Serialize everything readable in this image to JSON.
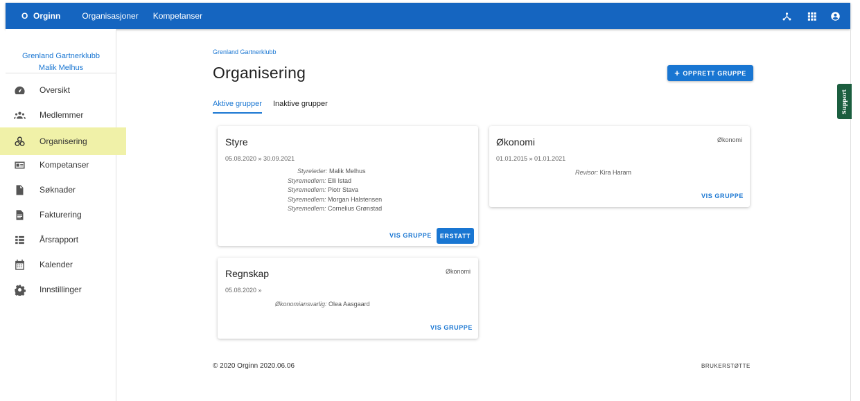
{
  "topbar": {
    "logo_letter": "O",
    "app_name": "Orginn",
    "nav": [
      "Organisasjoner",
      "Kompetanser"
    ],
    "icons": [
      "network-icon",
      "apps-grid-icon",
      "account-circle-icon"
    ]
  },
  "sidebar": {
    "club": "Grenland Gartnerklubb",
    "user": "Malik Melhus",
    "items": [
      {
        "label": "Oversikt",
        "icon": "dashboard-icon"
      },
      {
        "label": "Medlemmer",
        "icon": "members-icon"
      },
      {
        "label": "Organisering",
        "icon": "organisation-icon",
        "active": true
      },
      {
        "label": "Kompetanser",
        "icon": "id-card-icon"
      },
      {
        "label": "Søknader",
        "icon": "document-icon"
      },
      {
        "label": "Fakturering",
        "icon": "invoice-icon"
      },
      {
        "label": "Årsrapport",
        "icon": "report-list-icon"
      },
      {
        "label": "Kalender",
        "icon": "calendar-icon"
      },
      {
        "label": "Innstillinger",
        "icon": "settings-icon"
      }
    ]
  },
  "main": {
    "breadcrumb": "Grenland Gartnerklubb",
    "title": "Organisering",
    "create_button": "OPPRETT GRUPPE",
    "tabs": [
      "Aktive grupper",
      "Inaktive grupper"
    ],
    "cards": [
      {
        "title": "Styre",
        "tag": "",
        "dates": "05.08.2020 » 30.09.2021",
        "roles": [
          {
            "role": "Styreleder:",
            "name": "Malik Melhus"
          },
          {
            "role": "Styremedlem:",
            "name": "Elli Istad"
          },
          {
            "role": "Styremedlem:",
            "name": "Piotr Stava"
          },
          {
            "role": "Styremedlem:",
            "name": "Morgan Halstensen"
          },
          {
            "role": "Styremedlem:",
            "name": "Cornelius Grønstad"
          }
        ],
        "link": "VIS GRUPPE",
        "button": "ERSTATT"
      },
      {
        "title": "Økonomi",
        "tag": "Økonomi",
        "dates": "01.01.2015 » 01.01.2021",
        "roles": [
          {
            "role": "Revisor:",
            "name": "Kira Haram"
          }
        ],
        "link": "VIS GRUPPE"
      },
      {
        "title": "Regnskap",
        "tag": "Økonomi",
        "dates": "05.08.2020 »",
        "roles": [
          {
            "role": "Økonomiansvarlig:",
            "name": "Olea Aasgaard"
          }
        ],
        "link": "VIS GRUPPE"
      }
    ]
  },
  "footer": {
    "copyright": "© 2020 Orginn 2020.06.06",
    "support_link": "BRUKERSTØTTE"
  },
  "support_tab": "Support",
  "colors": {
    "primary": "#1565c0",
    "accent": "#1976d2",
    "active_highlight": "#f0f1a8",
    "support": "#1b5e3f"
  }
}
